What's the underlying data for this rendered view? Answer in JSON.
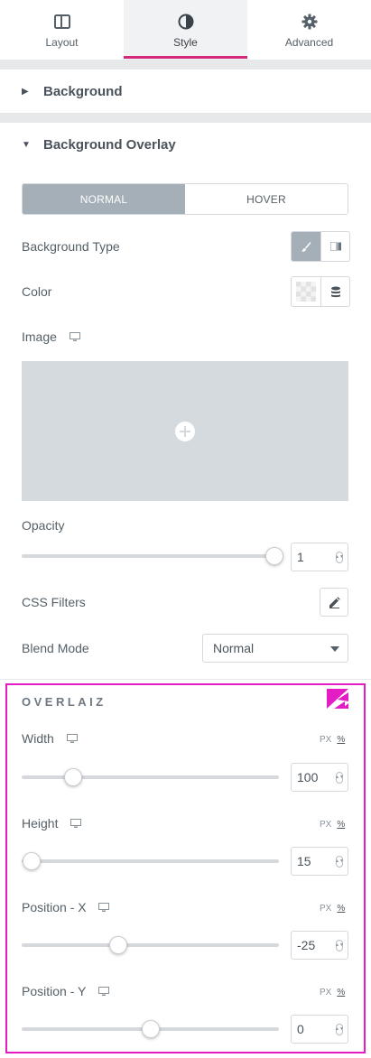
{
  "tabs": [
    {
      "label": "Layout",
      "icon": "layout-icon"
    },
    {
      "label": "Style",
      "icon": "style-icon"
    },
    {
      "label": "Advanced",
      "icon": "gear-icon"
    }
  ],
  "sections": {
    "background": "Background",
    "overlay": "Background Overlay"
  },
  "state_tabs": {
    "normal": "NORMAL",
    "hover": "HOVER"
  },
  "fields": {
    "background_type": "Background Type",
    "color": "Color",
    "image": "Image",
    "opacity": "Opacity",
    "css_filters": "CSS Filters",
    "blend_mode": "Blend Mode"
  },
  "values": {
    "opacity": "1",
    "opacity_fraction": 1.0,
    "blend_mode": "Normal"
  },
  "overlaiz": {
    "title": "OVERLAIZ",
    "unit_px": "PX",
    "unit_pct": "%",
    "width": {
      "label": "Width",
      "value": "100",
      "fraction": 0.19
    },
    "height": {
      "label": "Height",
      "value": "15",
      "fraction": 0.02
    },
    "position_x": {
      "label": "Position - X",
      "value": "-25",
      "fraction": 0.37
    },
    "position_y": {
      "label": "Position - Y",
      "value": "0",
      "fraction": 0.5
    }
  },
  "colors": {
    "accent": "#d6287b",
    "overlaiz_border": "#e31cc4",
    "selected": "#a4afb7"
  }
}
